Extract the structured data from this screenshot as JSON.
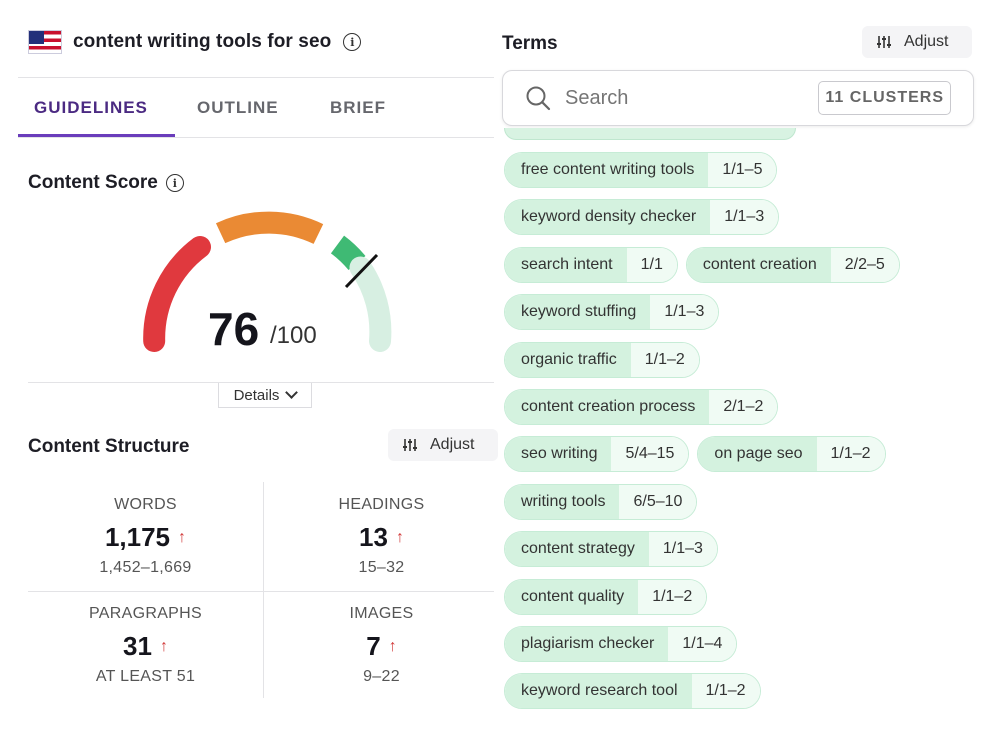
{
  "header": {
    "keyword": "content writing tools for seo",
    "info_icon": "info-icon"
  },
  "tabs": [
    {
      "label": "GUIDELINES",
      "active": true
    },
    {
      "label": "OUTLINE",
      "active": false
    },
    {
      "label": "BRIEF",
      "active": false
    }
  ],
  "content_score": {
    "title": "Content Score",
    "value": "76",
    "max": "/100",
    "details_label": "Details",
    "gauge_colors": {
      "low": "#e0393e",
      "mid": "#ea8a34",
      "high": "#3fba74",
      "track": "#d7efe2"
    }
  },
  "content_structure": {
    "title": "Content Structure",
    "adjust_label": "Adjust",
    "metrics": [
      {
        "label": "WORDS",
        "value": "1,175",
        "arrow": "↑",
        "range": "1,452–1,669"
      },
      {
        "label": "HEADINGS",
        "value": "13",
        "arrow": "↑",
        "range": "15–32"
      },
      {
        "label": "PARAGRAPHS",
        "value": "31",
        "arrow": "↑",
        "range": "AT LEAST 51"
      },
      {
        "label": "IMAGES",
        "value": "7",
        "arrow": "↑",
        "range": "9–22"
      }
    ]
  },
  "terms": {
    "title": "Terms",
    "adjust_label": "Adjust",
    "search_placeholder": "Search",
    "clusters_label": "11 CLUSTERS",
    "rows": [
      [
        {
          "term": "free content writing tools",
          "count": "1/1–5"
        }
      ],
      [
        {
          "term": "keyword density checker",
          "count": "1/1–3"
        }
      ],
      [
        {
          "term": "search intent",
          "count": "1/1"
        },
        {
          "term": "content creation",
          "count": "2/2–5"
        }
      ],
      [
        {
          "term": "keyword stuffing",
          "count": "1/1–3"
        }
      ],
      [
        {
          "term": "organic traffic",
          "count": "1/1–2"
        }
      ],
      [
        {
          "term": "content creation process",
          "count": "2/1–2"
        }
      ],
      [
        {
          "term": "seo writing",
          "count": "5/4–15"
        },
        {
          "term": "on page seo",
          "count": "1/1–2"
        }
      ],
      [
        {
          "term": "writing tools",
          "count": "6/5–10"
        }
      ],
      [
        {
          "term": "content strategy",
          "count": "1/1–3"
        }
      ],
      [
        {
          "term": "content quality",
          "count": "1/1–2"
        }
      ],
      [
        {
          "term": "plagiarism checker",
          "count": "1/1–4"
        }
      ],
      [
        {
          "term": "keyword research tool",
          "count": "1/1–2"
        }
      ]
    ]
  }
}
